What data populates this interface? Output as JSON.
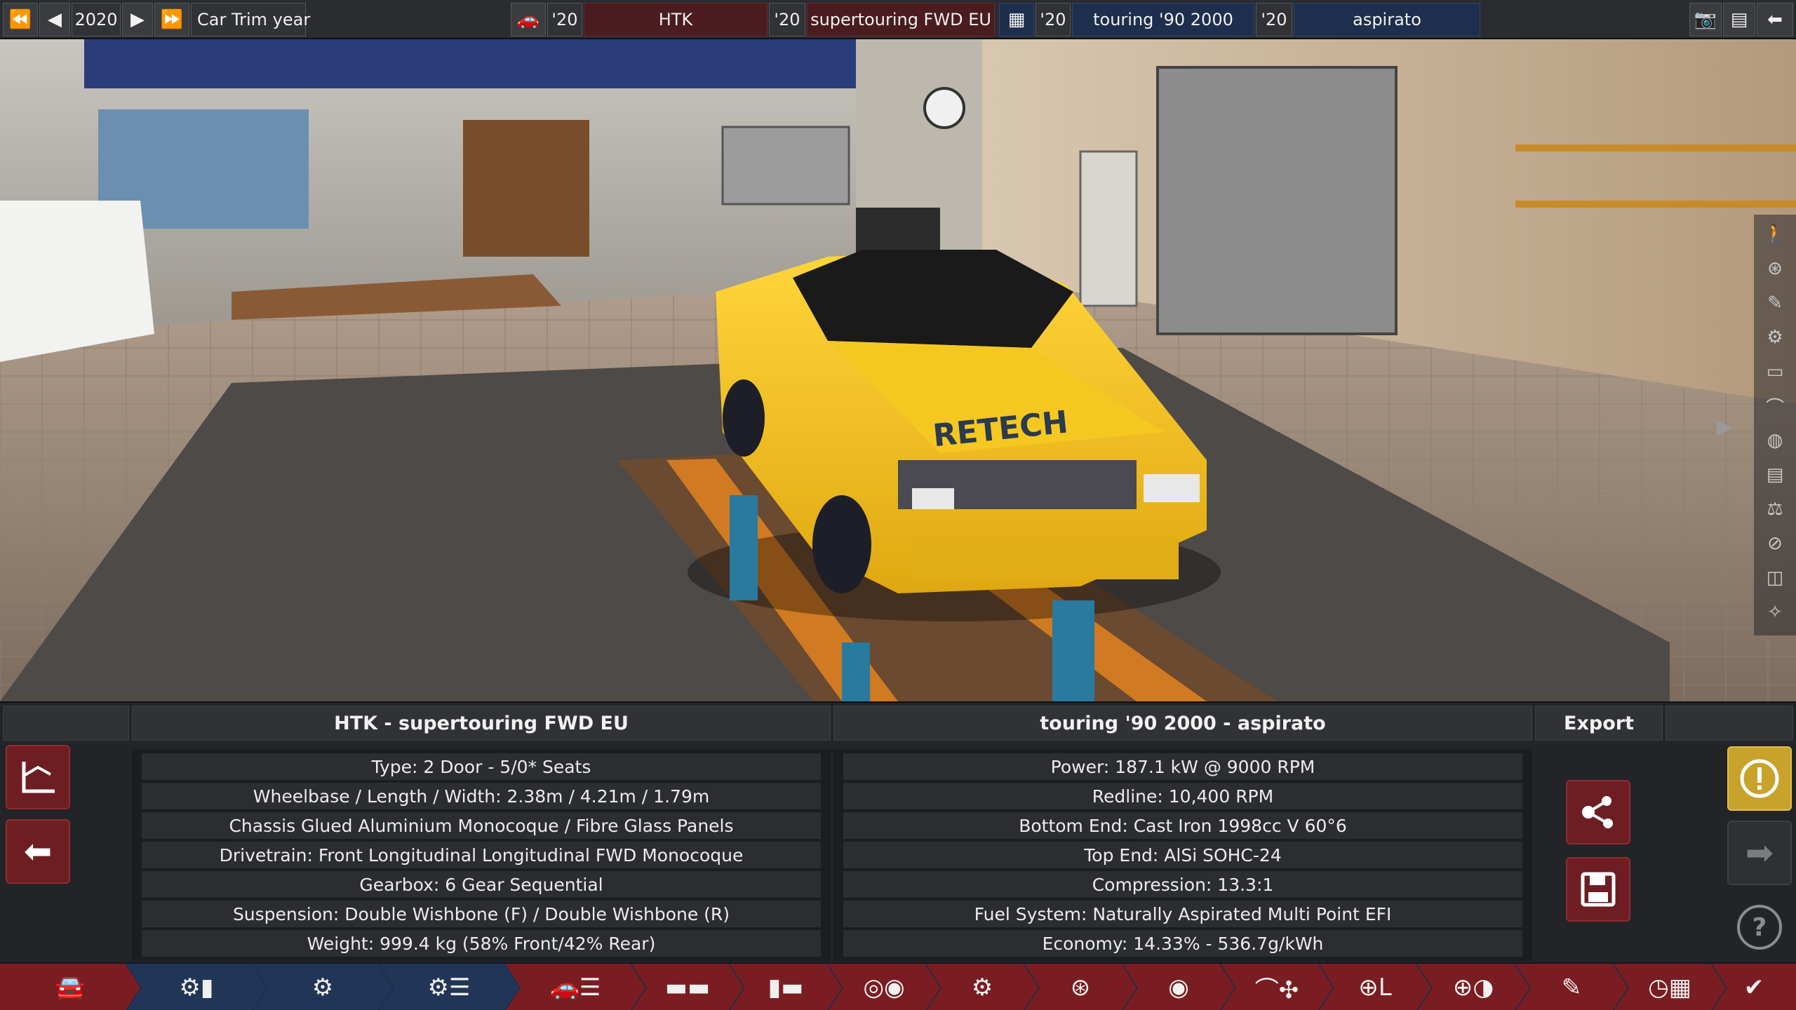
{
  "topbar": {
    "year": "2020",
    "year_label": "Car Trim year",
    "car_year_prefix": "'20",
    "car_model": "HTK",
    "trim_year_prefix": "'20",
    "trim_name": "supertouring FWD EU",
    "engine_year_prefix": "'20",
    "engine_family": "touring '90 2000",
    "variant_year_prefix": "'20",
    "variant_name": "aspirato",
    "icons": {
      "first": "fast-backward-icon",
      "prev": "prev-icon",
      "next": "next-icon",
      "last": "fast-forward-icon",
      "car": "car-model-icon",
      "engine": "engine-icon",
      "camera": "camera-icon",
      "calculator": "calculator-icon",
      "back": "back-arrow-icon"
    }
  },
  "viewport": {
    "car_decal": "RETECH"
  },
  "car_panel": {
    "title": "HTK - supertouring FWD EU",
    "rows": [
      "Type: 2 Door - 5/0* Seats",
      "Wheelbase / Length / Width: 2.38m / 4.21m / 1.79m",
      "Chassis Glued Aluminium Monocoque / Fibre Glass Panels",
      "Drivetrain: Front Longitudinal Longitudinal FWD Monocoque",
      "Gearbox: 6 Gear Sequential",
      "Suspension: Double Wishbone (F) / Double Wishbone (R)",
      "Weight: 999.4 kg (58% Front/42% Rear)"
    ]
  },
  "engine_panel": {
    "title": "touring '90 2000 - aspirato",
    "rows": [
      "Power: 187.1 kW @ 9000 RPM",
      "Redline:  10,400 RPM",
      "Bottom End: Cast Iron 1998cc V 60°6",
      "Top End: AlSi SOHC-24",
      "Compression: 13.3:1",
      "Fuel System: Naturally Aspirated Multi Point EFI",
      "Economy: 14.33% - 536.7g/kWh"
    ]
  },
  "export_panel": {
    "title": "Export"
  },
  "colors": {
    "accent_red": "#7a1d22",
    "accent_navy": "#213556",
    "warning_gold": "#c8a22a",
    "car_yellow": "#f2c418"
  }
}
